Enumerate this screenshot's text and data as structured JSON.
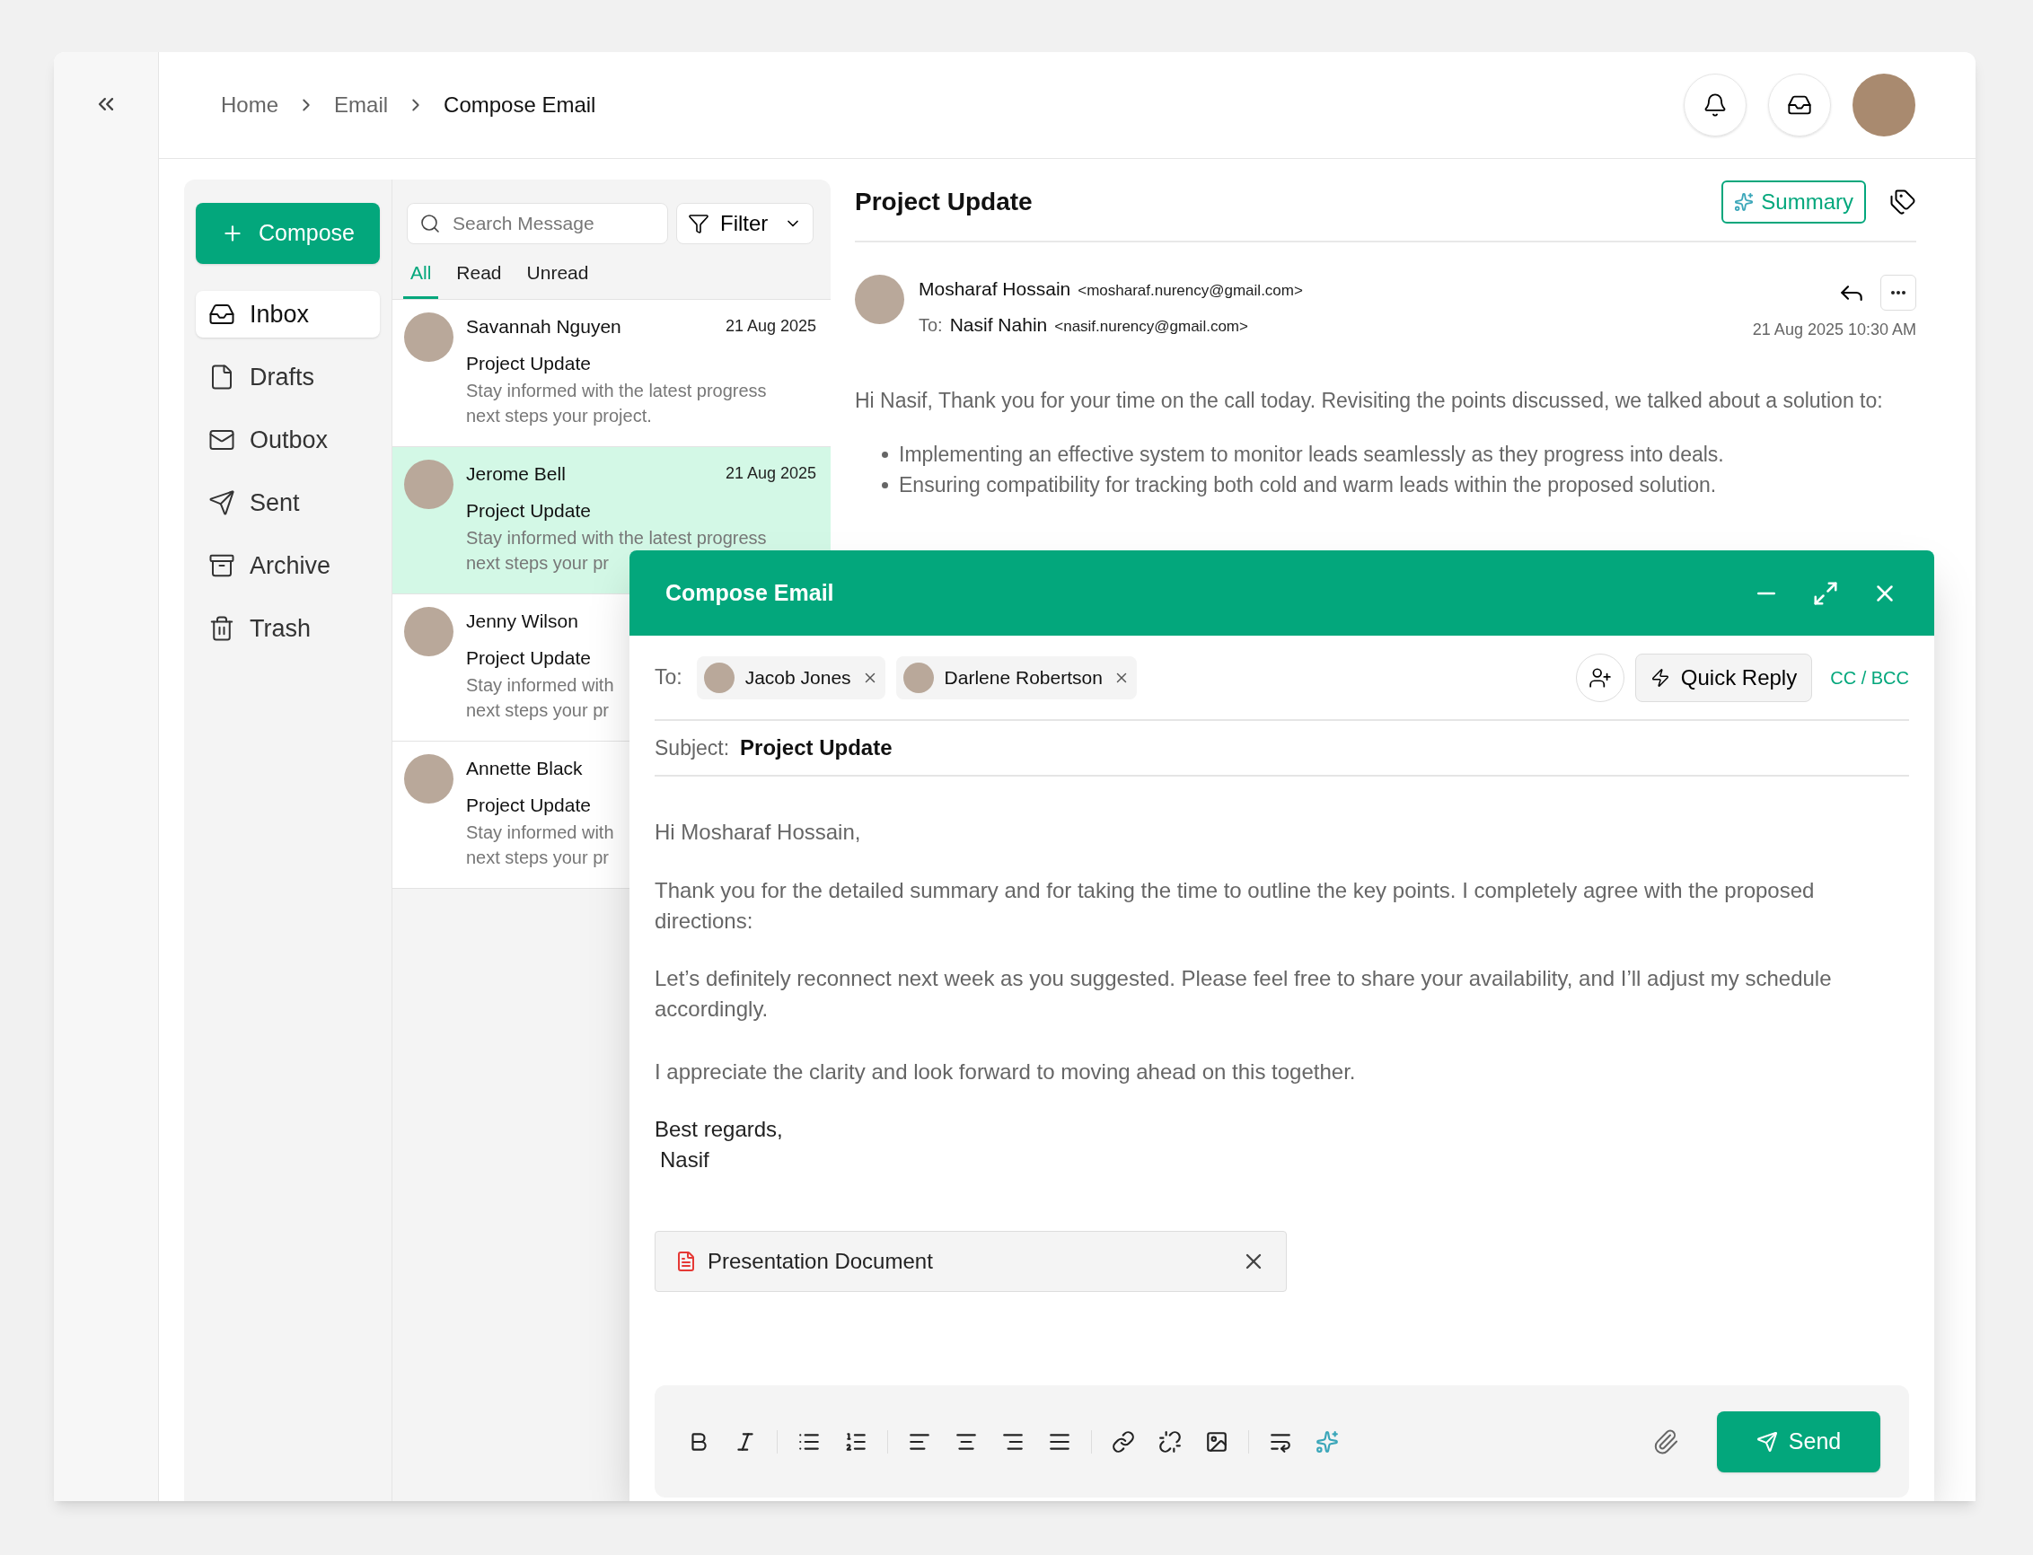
{
  "breadcrumbs": [
    {
      "label": "Home",
      "selected": false
    },
    {
      "label": "Email",
      "selected": false
    },
    {
      "label": "Compose Email",
      "selected": true
    }
  ],
  "nav": {
    "compose": "Compose",
    "items": [
      {
        "label": "Inbox",
        "kind": "inbox",
        "selected": true
      },
      {
        "label": "Drafts",
        "kind": "drafts",
        "selected": false
      },
      {
        "label": "Outbox",
        "kind": "outbox",
        "selected": false
      },
      {
        "label": "Sent",
        "kind": "sent",
        "selected": false
      },
      {
        "label": "Archive",
        "kind": "archive",
        "selected": false
      },
      {
        "label": "Trash",
        "kind": "trash",
        "selected": false
      }
    ]
  },
  "list": {
    "search_placeholder": "Search Message",
    "filter": "Filter",
    "tabs": [
      {
        "label": "All",
        "selected": true
      },
      {
        "label": "Read",
        "selected": false
      },
      {
        "label": "Unread",
        "selected": false
      }
    ],
    "messages": [
      {
        "sender": "Savannah Nguyen",
        "date": "21 Aug 2025",
        "subject": "Project Update",
        "preview": [
          "Stay informed with the latest progress",
          "next steps your project."
        ],
        "selected": false
      },
      {
        "sender": "Jerome Bell",
        "date": "21 Aug 2025",
        "subject": "Project Update",
        "preview": [
          "Stay informed with the latest progress",
          "next steps your pr"
        ],
        "selected": true
      },
      {
        "sender": "Jenny Wilson",
        "subject": "Project Update",
        "preview": [
          "Stay informed with",
          "next steps your pr"
        ],
        "selected": false
      },
      {
        "sender": "Annette Black",
        "subject": "Project Update",
        "preview": [
          "Stay informed with",
          "next steps your pr"
        ],
        "selected": false
      }
    ]
  },
  "email": {
    "title": "Project Update",
    "summary": "Summary",
    "from_name": "Mosharaf Hossain",
    "from_email": "<mosharaf.nurency@gmail.com>",
    "to_label": "To:",
    "to_name": "Nasif Nahin",
    "to_email": "<nasif.nurency@gmail.com>",
    "date": "21 Aug 2025 10:30 AM",
    "intro": "Hi Nasif, Thank you for your time on the call today. Revisiting the points discussed, we talked about a solution to:",
    "bullets": [
      "Implementing an effective system to monitor leads seamlessly as they progress into deals.",
      "Ensuring compatibility for tracking both cold and warm leads within the proposed solution."
    ]
  },
  "compose": {
    "title": "Compose Email",
    "to_label": "To:",
    "recipients": [
      {
        "name": "Jacob Jones"
      },
      {
        "name": "Darlene Robertson"
      }
    ],
    "quick_reply": "Quick Reply",
    "cc_bcc": "CC / BCC",
    "subject_label": "Subject:",
    "subject": "Project Update",
    "greeting": "Hi Mosharaf Hossain,",
    "paragraphs": [
      "Thank you for the detailed summary and for taking the time to outline the key points. I completely agree with the proposed directions:",
      "Let’s definitely reconnect next week as you suggested. Please feel free to share your availability, and I’ll adjust my schedule accordingly.",
      "I appreciate the clarity and look forward to moving ahead on this together."
    ],
    "signature": [
      "Best regards,",
      "Nasif"
    ],
    "attachment": "Presentation Document",
    "send": "Send"
  }
}
